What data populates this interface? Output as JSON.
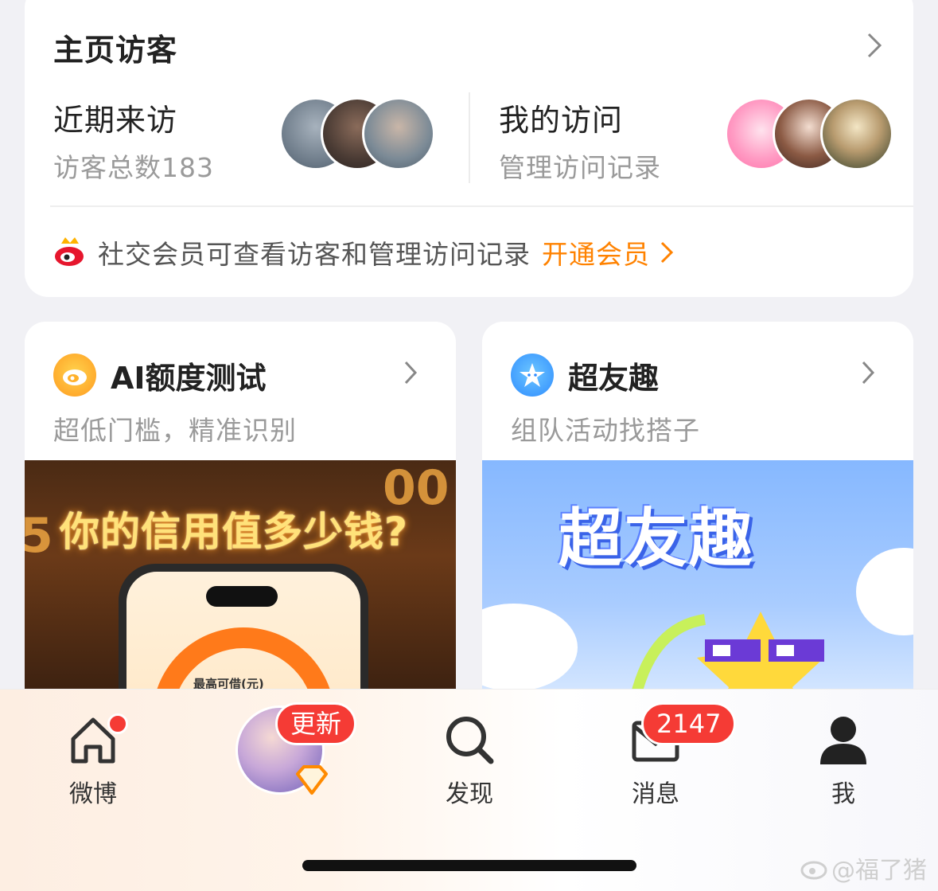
{
  "visitors": {
    "title": "主页访客",
    "recent": {
      "title": "近期来访",
      "subtitle": "访客总数183"
    },
    "mine": {
      "title": "我的访问",
      "subtitle": "管理访问记录"
    },
    "member_text": "社交会员可查看访客和管理访问记录",
    "member_link": "开通会员"
  },
  "cards": [
    {
      "title": "AI额度测试",
      "subtitle": "超低门槛，精准识别",
      "banner_text": "你的信用值多少钱?",
      "banner_label": "最高可借(元)",
      "icon": "weibo-orange-icon"
    },
    {
      "title": "超友趣",
      "subtitle": "组队活动找搭子",
      "banner_text": "超友趣",
      "icon": "star-blue-icon"
    }
  ],
  "tabbar": {
    "items": [
      {
        "label": "微博",
        "icon": "home-icon"
      },
      {
        "label": "发现",
        "icon": "search-icon"
      },
      {
        "label": "消息",
        "icon": "mail-icon"
      },
      {
        "label": "我",
        "icon": "person-icon"
      }
    ],
    "update_badge": "更新",
    "message_count": "2147"
  },
  "watermark": "@福了猪",
  "colors": {
    "accent": "#ff8200",
    "badge": "#f53b35",
    "text": "#222222",
    "muted": "#9a9a9a"
  }
}
